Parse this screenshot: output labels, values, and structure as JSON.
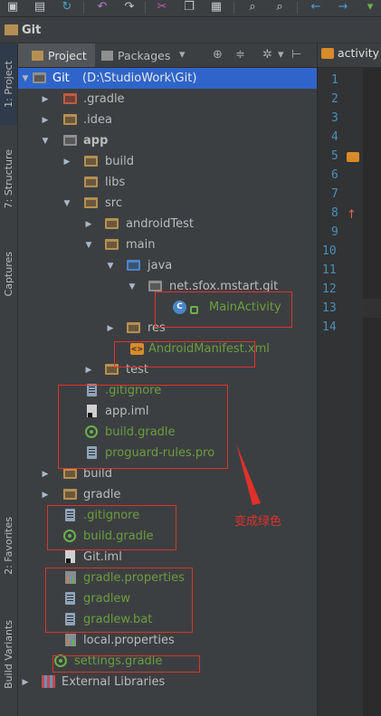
{
  "toolbar": {
    "icons": [
      "save-icon",
      "sync-icon",
      "undo-icon",
      "redo-icon",
      "cut-icon",
      "copy-icon",
      "paste-icon",
      "find-icon",
      "replace-icon",
      "back-icon",
      "forward-icon",
      "run-icon"
    ]
  },
  "navbar": {
    "label": "Git"
  },
  "side_tabs": {
    "project": "1: Project",
    "structure": "7: Structure",
    "captures": "Captures",
    "favorites": "2: Favorites",
    "build_variants": "Build Variants"
  },
  "panel_tabs": {
    "project": "Project",
    "packages": "Packages"
  },
  "tree": {
    "root_name": "Git",
    "root_path": "(D:\\StudioWork\\Git)",
    "items": [
      {
        "label": ".gradle"
      },
      {
        "label": ".idea"
      },
      {
        "label": "app"
      },
      {
        "label": "build"
      },
      {
        "label": "libs"
      },
      {
        "label": "src"
      },
      {
        "label": "androidTest"
      },
      {
        "label": "main"
      },
      {
        "label": "java"
      },
      {
        "label": "net.sfox.mstart.git"
      },
      {
        "label": "MainActivity"
      },
      {
        "label": "res"
      },
      {
        "label": "AndroidManifest.xml"
      },
      {
        "label": "test"
      },
      {
        "label": ".gitignore"
      },
      {
        "label": "app.iml"
      },
      {
        "label": "build.gradle"
      },
      {
        "label": "proguard-rules.pro"
      },
      {
        "label": "build"
      },
      {
        "label": "gradle"
      },
      {
        "label": ".gitignore"
      },
      {
        "label": "build.gradle"
      },
      {
        "label": "Git.iml"
      },
      {
        "label": "gradle.properties"
      },
      {
        "label": "gradlew"
      },
      {
        "label": "gradlew.bat"
      },
      {
        "label": "local.properties"
      },
      {
        "label": "settings.gradle"
      },
      {
        "label": "External Libraries"
      }
    ]
  },
  "editor": {
    "tab_label": "activity",
    "line_numbers": [
      "1",
      "2",
      "3",
      "4",
      "5",
      "6",
      "7",
      "8",
      "9",
      "10",
      "11",
      "12",
      "13",
      "14"
    ]
  },
  "annotation": {
    "text": "变成绿色"
  },
  "colors": {
    "vcs_added": "#6a9e3f",
    "selection": "#2f65ca",
    "annotation_red": "#e0312a"
  }
}
